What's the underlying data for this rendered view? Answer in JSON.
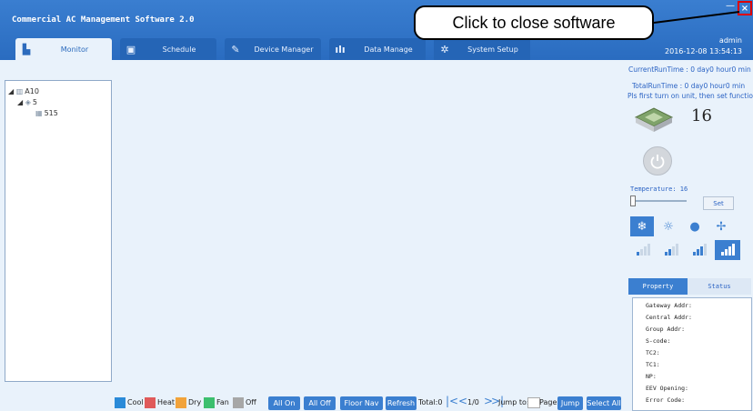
{
  "app": {
    "title": "Commercial AC Management Software 2.0"
  },
  "tabs": [
    {
      "label": "Monitor",
      "icon": "monitor-icon"
    },
    {
      "label": "Schedule",
      "icon": "calendar-icon"
    },
    {
      "label": "Device Manager",
      "icon": "wrench-icon"
    },
    {
      "label": "Data Manage",
      "icon": "bar-chart-icon"
    },
    {
      "label": "System Setup",
      "icon": "gear-icon"
    }
  ],
  "user": {
    "name": "admin",
    "datetime": "2016-12-08 13:54:13"
  },
  "window": {
    "min_glyph": "—",
    "close_glyph": "×"
  },
  "callout": {
    "text": "Click to close software"
  },
  "tree": [
    {
      "label": "A10",
      "expander": "◢",
      "icon": "building-icon",
      "glyph": "▥"
    },
    {
      "label": "5",
      "expander": "◢",
      "icon": "floor-icon",
      "glyph": "◈"
    },
    {
      "label": "515",
      "expander": "",
      "icon": "unit-icon",
      "glyph": "▦"
    }
  ],
  "legend": [
    {
      "label": "Cool",
      "color": "#2a8ad8"
    },
    {
      "label": "Heat",
      "color": "#e05a5a"
    },
    {
      "label": "Dry",
      "color": "#f2a33a"
    },
    {
      "label": "Fan",
      "color": "#3cbf6e"
    },
    {
      "label": "Off",
      "color": "#a7a7a7"
    }
  ],
  "toolbar": {
    "all_on": "All On",
    "all_off": "All Off",
    "floor_nav": "Floor Nav",
    "refresh": "Refresh",
    "total": "Total:0",
    "page_info": "1/0",
    "jump_to": "Jump to:",
    "page": "Page",
    "jump": "Jump",
    "select_all": "Select All"
  },
  "panel": {
    "current_run": "CurrentRunTime : 0 day0 hour0 min",
    "total_run": "TotalRunTime : 0 day0 hour0 min",
    "hint": "Pls first turn on unit, then set function.",
    "set_temp": "16",
    "temperature_label": "Temperature: 16",
    "set_button": "Set",
    "temperature_slider": 0,
    "modes": [
      "cool-mode",
      "heat-mode",
      "dry-mode",
      "fan-mode"
    ],
    "fan_speeds": [
      "fan-speed-1",
      "fan-speed-2",
      "fan-speed-3",
      "fan-speed-auto"
    ],
    "tab_property": "Property",
    "tab_status": "Status",
    "properties": [
      "Gateway Addr:",
      "Central Addr:",
      "Group Addr:",
      "S-code:",
      "TC2:",
      "TC1:",
      "NP:",
      "EEV Opening:",
      "Error Code:"
    ]
  },
  "colors": {
    "accent": "#3b7fd0",
    "header": "#2a6cc0",
    "highlight": "#dd0000"
  }
}
